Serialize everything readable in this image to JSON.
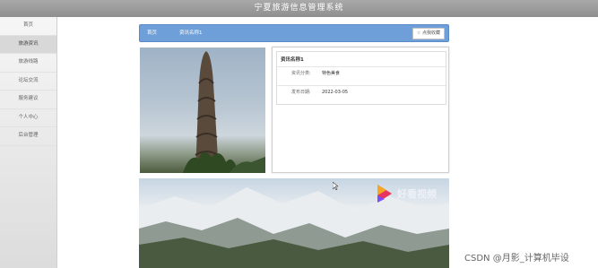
{
  "app": {
    "title": "宁夏旅游信息管理系统"
  },
  "sidebar": {
    "items": [
      {
        "label": "首页"
      },
      {
        "label": "旅游资讯",
        "active": true
      },
      {
        "label": "旅游线路"
      },
      {
        "label": "论坛交流"
      },
      {
        "label": "服务建议"
      },
      {
        "label": "个人中心"
      },
      {
        "label": "后台管理"
      }
    ]
  },
  "breadcrumb": {
    "home": "首页",
    "current": "资讯名称1"
  },
  "favorite_button": {
    "icon": "star-outline-icon",
    "label": "点我收藏"
  },
  "article": {
    "title": "资讯名称1",
    "category_label": "资讯分类:",
    "category_value": "特色美食",
    "date_label": "发布日期:",
    "date_value": "2022-03-05"
  },
  "watermark": {
    "logo_icon": "play-logo-icon",
    "text": "好看视频"
  },
  "footer_watermark": "CSDN @月影_计算机毕设",
  "colors": {
    "topbar": "#999999",
    "breadcrumb_bar": "#6f9fd8",
    "accent_logo": "#e8355e"
  }
}
